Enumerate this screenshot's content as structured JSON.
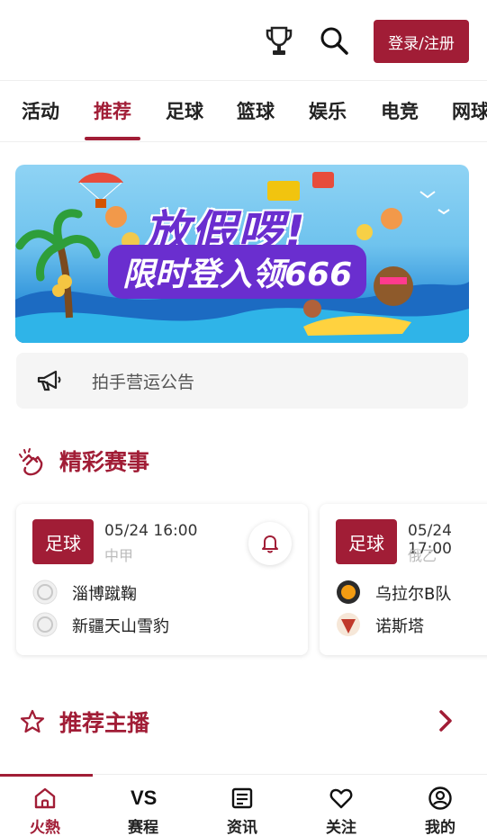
{
  "header": {
    "trophy_icon": "trophy-icon",
    "search_icon": "search-icon",
    "login_label": "登录/注册"
  },
  "tabs": [
    {
      "label": "活动"
    },
    {
      "label": "推荐",
      "active": true
    },
    {
      "label": "足球"
    },
    {
      "label": "篮球"
    },
    {
      "label": "娱乐"
    },
    {
      "label": "电竞"
    },
    {
      "label": "网球"
    }
  ],
  "banner": {
    "title": "放假啰!",
    "subtitle": "限时登入领666",
    "dot_count": 6,
    "active_dot": 4
  },
  "notice": {
    "icon": "megaphone-icon",
    "text": "拍手营运公告"
  },
  "sections": {
    "featured": {
      "icon": "clap-icon",
      "title": "精彩赛事"
    },
    "streamers": {
      "icon": "star-icon",
      "title": "推荐主播",
      "more_icon": "chevron-right-icon"
    }
  },
  "matches": [
    {
      "sport": "足球",
      "time": "05/24 16:00",
      "league": "中甲",
      "home": "淄博蹴鞠",
      "away": "新疆天山雪豹",
      "bell_icon": "bell-icon"
    },
    {
      "sport": "足球",
      "time": "05/24 17:00",
      "league": "俄乙",
      "home": "乌拉尔B队",
      "away": "诺斯塔",
      "bell_icon": "bell-icon"
    }
  ],
  "bottom_nav": [
    {
      "label": "火熱",
      "icon": "home-icon",
      "active": true
    },
    {
      "label": "赛程",
      "icon": "vs-icon",
      "text": "VS"
    },
    {
      "label": "资讯",
      "icon": "news-icon"
    },
    {
      "label": "关注",
      "icon": "heart-icon"
    },
    {
      "label": "我的",
      "icon": "profile-icon"
    }
  ],
  "colors": {
    "accent": "#a11d36",
    "muted": "#bbbbbb",
    "notice_bg": "#f5f5f5"
  }
}
